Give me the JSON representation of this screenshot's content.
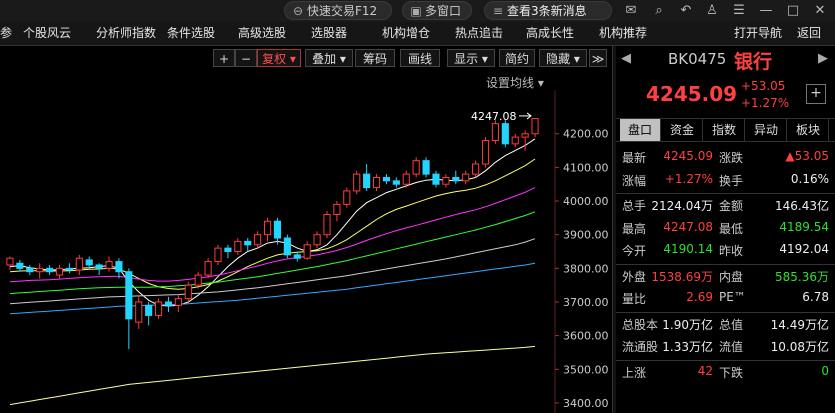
{
  "topbar": {
    "quick_trade": "快速交易F12",
    "multi_window": "多窗口",
    "news": "查看3条新消息"
  },
  "menu": [
    "参",
    "个股风云",
    "分析师指数",
    "条件选股",
    "高级选股",
    "选股器",
    "机构增仓",
    "热点追击",
    "高成长性",
    "机构推荐",
    "打开导航",
    "返回"
  ],
  "toolbar": {
    "fuquan": "复权",
    "diejia": "叠加",
    "chouma": "筹码",
    "huaxian": "画线",
    "xianshi": "显示",
    "jianyue": "简约",
    "yincang": "隐藏",
    "set_ma": "设置均线"
  },
  "chart_data": {
    "type": "candlestick",
    "yticks": [
      3400,
      3500,
      3600,
      3700,
      3800,
      3900,
      4000,
      4100,
      4200
    ],
    "ytick_labels": [
      "3400.00",
      "3500.00",
      "3600.00",
      "3700.00",
      "3800.00",
      "3900.00",
      "4000.00",
      "4100.00",
      "4200.00"
    ],
    "ylim": [
      3370,
      4330
    ],
    "annotation": "4247.08",
    "candles": [
      [
        3810,
        3830,
        3795,
        3835
      ],
      [
        3815,
        3800,
        3790,
        3825
      ],
      [
        3800,
        3790,
        3780,
        3810
      ],
      [
        3790,
        3800,
        3770,
        3815
      ],
      [
        3800,
        3790,
        3780,
        3810
      ],
      [
        3780,
        3800,
        3770,
        3810
      ],
      [
        3800,
        3795,
        3785,
        3815
      ],
      [
        3795,
        3830,
        3780,
        3840
      ],
      [
        3825,
        3810,
        3800,
        3835
      ],
      [
        3810,
        3800,
        3780,
        3815
      ],
      [
        3800,
        3820,
        3790,
        3835
      ],
      [
        3820,
        3790,
        3770,
        3830
      ],
      [
        3790,
        3650,
        3560,
        3800
      ],
      [
        3640,
        3700,
        3620,
        3720
      ],
      [
        3690,
        3660,
        3630,
        3700
      ],
      [
        3660,
        3700,
        3650,
        3710
      ],
      [
        3700,
        3690,
        3670,
        3715
      ],
      [
        3690,
        3710,
        3670,
        3720
      ],
      [
        3710,
        3750,
        3700,
        3760
      ],
      [
        3750,
        3780,
        3740,
        3790
      ],
      [
        3780,
        3820,
        3770,
        3830
      ],
      [
        3820,
        3860,
        3810,
        3870
      ],
      [
        3860,
        3850,
        3830,
        3870
      ],
      [
        3850,
        3880,
        3840,
        3890
      ],
      [
        3880,
        3870,
        3850,
        3890
      ],
      [
        3870,
        3900,
        3860,
        3910
      ],
      [
        3900,
        3940,
        3880,
        3950
      ],
      [
        3940,
        3890,
        3870,
        3950
      ],
      [
        3890,
        3840,
        3830,
        3900
      ],
      [
        3840,
        3830,
        3820,
        3850
      ],
      [
        3830,
        3870,
        3825,
        3880
      ],
      [
        3870,
        3900,
        3860,
        3910
      ],
      [
        3900,
        3960,
        3890,
        3970
      ],
      [
        3960,
        3990,
        3940,
        4000
      ],
      [
        3990,
        4030,
        3980,
        4040
      ],
      [
        4030,
        4080,
        4020,
        4090
      ],
      [
        4080,
        4040,
        4030,
        4110
      ],
      [
        4040,
        4070,
        4030,
        4080
      ],
      [
        4070,
        4060,
        4050,
        4080
      ],
      [
        4060,
        4050,
        4040,
        4070
      ],
      [
        4050,
        4080,
        4040,
        4090
      ],
      [
        4080,
        4120,
        4070,
        4130
      ],
      [
        4120,
        4080,
        4070,
        4130
      ],
      [
        4080,
        4050,
        4040,
        4090
      ],
      [
        4050,
        4070,
        4040,
        4080
      ],
      [
        4070,
        4060,
        4050,
        4090
      ],
      [
        4060,
        4080,
        4050,
        4090
      ],
      [
        4080,
        4110,
        4070,
        4120
      ],
      [
        4110,
        4180,
        4100,
        4190
      ],
      [
        4180,
        4230,
        4170,
        4240
      ],
      [
        4230,
        4170,
        4160,
        4240
      ],
      [
        4170,
        4190,
        4160,
        4200
      ],
      [
        4190,
        4200,
        4150,
        4210
      ],
      [
        4200,
        4245,
        4190,
        4247
      ]
    ],
    "ma": [
      {
        "color": "#ffffff",
        "values": [
          3805,
          3808,
          3802,
          3798,
          3795,
          3796,
          3798,
          3800,
          3802,
          3805,
          3808,
          3800,
          3760,
          3730,
          3705,
          3690,
          3688,
          3690,
          3700,
          3720,
          3745,
          3775,
          3805,
          3830,
          3850,
          3860,
          3875,
          3880,
          3875,
          3860,
          3850,
          3855,
          3870,
          3900,
          3935,
          3970,
          3995,
          4010,
          4025,
          4035,
          4045,
          4055,
          4062,
          4065,
          4062,
          4060,
          4063,
          4070,
          4090,
          4115,
          4135,
          4150,
          4165,
          4185
        ]
      },
      {
        "color": "#ffff66",
        "values": [
          3790,
          3792,
          3793,
          3793,
          3792,
          3792,
          3793,
          3795,
          3797,
          3798,
          3800,
          3798,
          3785,
          3770,
          3755,
          3745,
          3740,
          3738,
          3740,
          3745,
          3752,
          3762,
          3775,
          3790,
          3805,
          3818,
          3830,
          3840,
          3845,
          3848,
          3850,
          3852,
          3858,
          3870,
          3885,
          3905,
          3925,
          3945,
          3962,
          3975,
          3985,
          3995,
          4005,
          4015,
          4022,
          4028,
          4032,
          4038,
          4048,
          4060,
          4075,
          4090,
          4105,
          4125
        ]
      },
      {
        "color": "#ff33ff",
        "values": [
          3760,
          3762,
          3764,
          3765,
          3766,
          3768,
          3770,
          3772,
          3774,
          3775,
          3776,
          3776,
          3772,
          3768,
          3764,
          3762,
          3762,
          3764,
          3767,
          3771,
          3775,
          3780,
          3786,
          3793,
          3800,
          3807,
          3815,
          3822,
          3828,
          3832,
          3836,
          3840,
          3846,
          3853,
          3862,
          3872,
          3883,
          3893,
          3903,
          3912,
          3920,
          3928,
          3936,
          3944,
          3952,
          3960,
          3967,
          3974,
          3983,
          3993,
          4004,
          4015,
          4026,
          4040
        ]
      },
      {
        "color": "#33ff33",
        "values": [
          3725,
          3727,
          3729,
          3731,
          3733,
          3735,
          3737,
          3739,
          3741,
          3742,
          3743,
          3744,
          3744,
          3744,
          3744,
          3745,
          3746,
          3748,
          3750,
          3753,
          3756,
          3759,
          3763,
          3767,
          3771,
          3775,
          3780,
          3785,
          3790,
          3795,
          3800,
          3805,
          3811,
          3817,
          3823,
          3830,
          3837,
          3844,
          3851,
          3858,
          3865,
          3872,
          3879,
          3886,
          3893,
          3900,
          3907,
          3914,
          3922,
          3930,
          3939,
          3948,
          3957,
          3968
        ]
      },
      {
        "color": "#cccccc",
        "values": [
          3695,
          3697,
          3699,
          3701,
          3703,
          3705,
          3707,
          3709,
          3711,
          3713,
          3715,
          3716,
          3717,
          3718,
          3719,
          3720,
          3721,
          3722,
          3724,
          3726,
          3728,
          3730,
          3733,
          3736,
          3739,
          3742,
          3746,
          3750,
          3754,
          3758,
          3762,
          3766,
          3770,
          3774,
          3778,
          3783,
          3788,
          3793,
          3798,
          3803,
          3808,
          3813,
          3818,
          3823,
          3828,
          3834,
          3840,
          3846,
          3852,
          3858,
          3864,
          3870,
          3878,
          3888
        ]
      },
      {
        "color": "#33aaff",
        "values": [
          3665,
          3667,
          3669,
          3671,
          3673,
          3675,
          3677,
          3679,
          3681,
          3683,
          3685,
          3687,
          3688,
          3689,
          3690,
          3691,
          3692,
          3693,
          3695,
          3697,
          3699,
          3701,
          3703,
          3705,
          3708,
          3711,
          3714,
          3717,
          3720,
          3723,
          3726,
          3729,
          3732,
          3735,
          3738,
          3742,
          3746,
          3750,
          3754,
          3758,
          3762,
          3766,
          3770,
          3774,
          3778,
          3782,
          3786,
          3790,
          3794,
          3798,
          3802,
          3806,
          3810,
          3815
        ]
      },
      {
        "color": "#ffff99",
        "values": [
          3395,
          3400,
          3405,
          3410,
          3415,
          3420,
          3425,
          3430,
          3435,
          3440,
          3445,
          3450,
          3455,
          3458,
          3461,
          3464,
          3467,
          3470,
          3473,
          3476,
          3479,
          3482,
          3485,
          3488,
          3491,
          3494,
          3497,
          3500,
          3503,
          3506,
          3509,
          3512,
          3515,
          3518,
          3521,
          3524,
          3527,
          3530,
          3533,
          3536,
          3539,
          3542,
          3545,
          3547,
          3549,
          3551,
          3553,
          3555,
          3557,
          3559,
          3561,
          3563,
          3565,
          3568
        ]
      }
    ]
  },
  "panel": {
    "code": "BK0475",
    "name": "银行",
    "price": "4245.09",
    "change": "+53.05",
    "change_pct": "+1.27%",
    "tabs": [
      "盘口",
      "资金",
      "指数",
      "异动",
      "板块"
    ],
    "rows": [
      {
        "l1": "最新",
        "v1": "4245.09",
        "c1": "red",
        "l2": "涨跌",
        "v2": "▲53.05",
        "c2": "red"
      },
      {
        "l1": "涨幅",
        "v1": "+1.27%",
        "c1": "red",
        "l2": "换手",
        "v2": "0.16%",
        "c2": "white"
      },
      {
        "l1": "总手",
        "v1": "2124.04万",
        "c1": "white",
        "l2": "金额",
        "v2": "146.43亿",
        "c2": "white"
      },
      {
        "l1": "最高",
        "v1": "4247.08",
        "c1": "red",
        "l2": "最低",
        "v2": "4189.54",
        "c2": "green"
      },
      {
        "l1": "今开",
        "v1": "4190.14",
        "c1": "green",
        "l2": "昨收",
        "v2": "4192.04",
        "c2": "white"
      },
      {
        "l1": "外盘",
        "v1": "1538.69万",
        "c1": "red",
        "l2": "内盘",
        "v2": "585.36万",
        "c2": "green"
      },
      {
        "l1": "量比",
        "v1": "2.69",
        "c1": "red",
        "l2": "PE™",
        "v2": "6.78",
        "c2": "white"
      },
      {
        "l1": "总股本",
        "v1": "1.90万亿",
        "c1": "white",
        "l2": "总值",
        "v2": "14.49万亿",
        "c2": "white"
      },
      {
        "l1": "流通股",
        "v1": "1.33万亿",
        "c1": "white",
        "l2": "流值",
        "v2": "10.08万亿",
        "c2": "white"
      },
      {
        "l1": "上涨",
        "v1": "42",
        "c1": "red",
        "l2": "下跌",
        "v2": "0",
        "c2": "green"
      }
    ]
  }
}
